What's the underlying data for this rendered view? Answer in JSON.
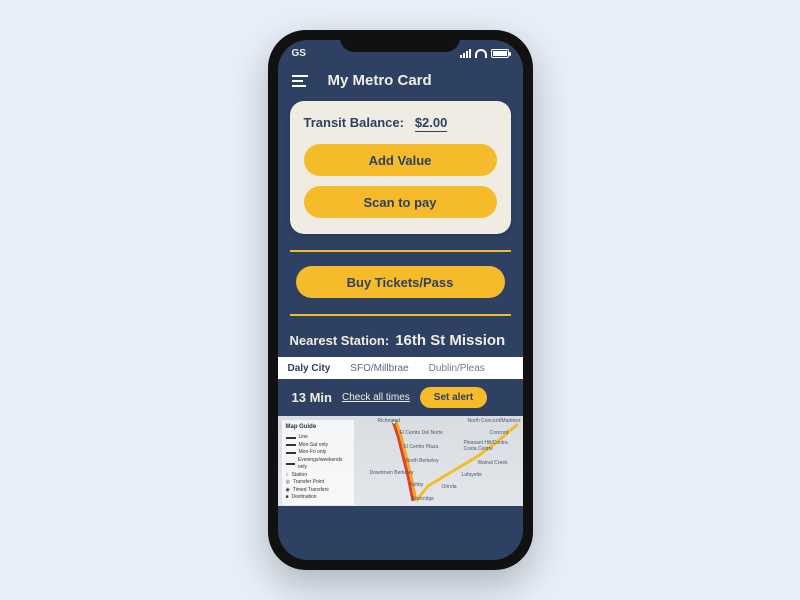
{
  "statusbar": {
    "left": "GS"
  },
  "header": {
    "title": "My Metro Card"
  },
  "balance": {
    "label": "Transit Balance:",
    "amount": "$2.00",
    "add_value": "Add Value",
    "scan": "Scan to pay"
  },
  "buy_tickets": "Buy Tickets/Pass",
  "station": {
    "label": "Nearest Station:",
    "name": "16th St Mission"
  },
  "tabs": [
    "Daly City",
    "SFO/Millbrae",
    "Dublin/Pleas"
  ],
  "arrival": {
    "minutes": "13 Min",
    "check_all": "Check all times",
    "set_alert": "Set alert"
  },
  "map_legend": {
    "title": "Map Guide",
    "items": [
      "Line",
      "Mon-Sat only",
      "Mon-Fri only",
      "Evenings/weekends only",
      "Station",
      "Transfer Point",
      "Timed Transfers",
      "Destination"
    ]
  },
  "map_labels": {
    "richmond": "Richmond",
    "elcerrito_n": "El Cerrito Del Norte",
    "elcerrito_p": "El Cerrito Plaza",
    "nberk": "North Berkeley",
    "dberk": "Downtown Berkeley",
    "ashby": "Ashby",
    "rockridge": "Rockridge",
    "concord_n": "North Concord/Martinez",
    "concord": "Concord",
    "phill": "Pleasant Hill/Contra Costa Centre",
    "walnut": "Walnut Creek",
    "lafayette": "Lafayette",
    "orinda": "Orinda"
  }
}
